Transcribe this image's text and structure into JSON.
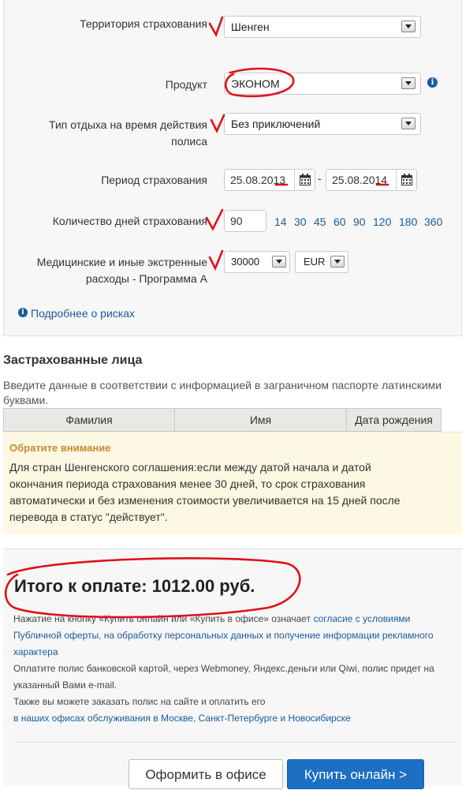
{
  "form": {
    "territory": {
      "label": "Территория страхования",
      "value": "Шенген"
    },
    "product": {
      "label": "Продукт",
      "value": "ЭКОНОМ"
    },
    "rest_type": {
      "label_line1": "Тип отдыха на время действия",
      "label_line2": "полиса",
      "value": "Без приключений"
    },
    "period": {
      "label": "Период страхования",
      "from": "25.08.2013",
      "separator": "-",
      "to": "25.08.2014"
    },
    "days": {
      "label": "Количество дней страхования",
      "value": "90",
      "quick": [
        "14",
        "30",
        "45",
        "60",
        "90",
        "120",
        "180",
        "360"
      ]
    },
    "medical": {
      "label_line1": "Медицинские и иные экстренные",
      "label_line2": "расходы - Программа А",
      "amount": "30000",
      "currency": "EUR"
    },
    "risks_link": "Подробнее о рисках"
  },
  "insured": {
    "title": "Застрахованные лица",
    "hint_line1": "Введите данные в соответствии с информацией в заграничном паспорте латинскими",
    "hint_line2": "буквами.",
    "columns": [
      "Фамилия",
      "Имя",
      "Дата рождения"
    ]
  },
  "notice": {
    "title": "Обратите внимание",
    "lines": [
      "Для стран Шенгенского соглашения:если между датой начала и датой",
      "окончания периода страхования менее 30 дней, то срок страхования",
      "автоматически и без изменения стоимости увеличивается на 15 дней после",
      "перевода в статус \"действует\"."
    ]
  },
  "payment": {
    "total": "Итого к оплате: 1012.00 руб.",
    "text1": "Нажатие на кнопку «Купить онлайн или «Купить в офисе» означает",
    "link1a": "согласие с условиями",
    "link1b": "Публичной оферты, на обработку персональных данных и получение информации рекламного",
    "link1c": "характера",
    "text2a": "Оплатите полис банковской картой, через Webmoney, Яндекс.деньги или Qiwi, полис придет на",
    "text2b": "указанный Вами e-mail.",
    "text3": "Также вы можете заказать полис на сайте и оплатить его",
    "link3": "в наших офисах обслуживания в Москве, Санкт-Петербурге и Новосибирске",
    "btn_office": "Оформить в офисе",
    "btn_buy": "Купить онлайн >"
  },
  "colors": {
    "link": "#1a5a9a",
    "buy_button": "#1d6fc3",
    "annotation": "#e0101a",
    "notice_bg": "#fcf8e3"
  }
}
